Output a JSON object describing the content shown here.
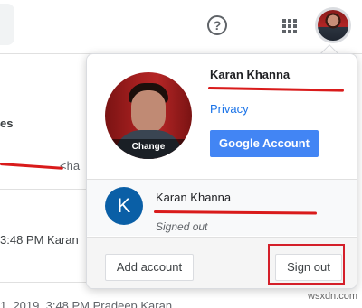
{
  "header": {
    "help_icon": "help-circle-icon",
    "apps_icon": "apps-grid-icon",
    "avatar": "profile-avatar"
  },
  "background": {
    "items": [
      "es",
      "3:48 PM Karan",
      "1, 2019, 3:48 PM Pradeep Karan"
    ]
  },
  "popup": {
    "name": "Karan Khanna",
    "change_label": "Change",
    "privacy_label": "Privacy",
    "google_account_label": "Google Account",
    "other_account": {
      "initial": "K",
      "name": "Karan Khanna",
      "status": "Signed out"
    },
    "add_account_label": "Add account",
    "sign_out_label": "Sign out"
  },
  "colors": {
    "primary_button": "#4285f4",
    "link": "#1a73e8",
    "avatar_bg": "#0a5fa6",
    "highlight": "#d41f2a",
    "redaction": "#d91b1b"
  },
  "watermark": "wsxdn.com"
}
